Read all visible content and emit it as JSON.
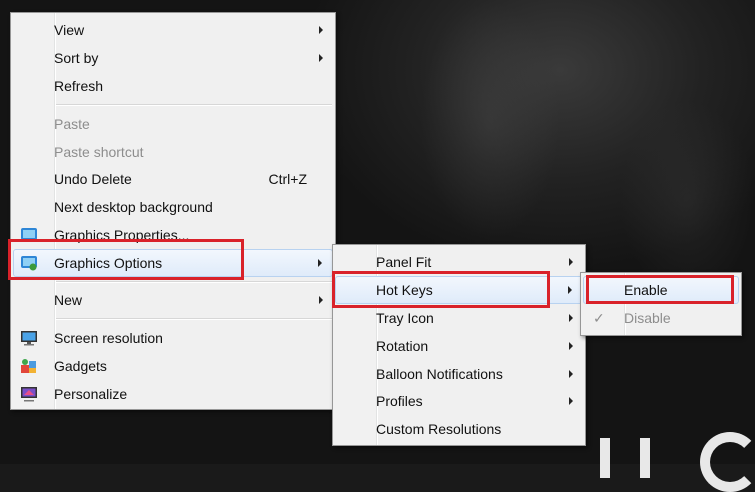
{
  "context_menu": {
    "items": [
      {
        "label": "View",
        "submenu": true
      },
      {
        "label": "Sort by",
        "submenu": true
      },
      {
        "label": "Refresh"
      },
      {
        "label": "Paste",
        "disabled": true
      },
      {
        "label": "Paste shortcut",
        "disabled": true
      },
      {
        "label": "Undo Delete",
        "shortcut": "Ctrl+Z"
      },
      {
        "label": "Next desktop background"
      },
      {
        "label": "Graphics Properties..."
      },
      {
        "label": "Graphics Options",
        "submenu": true,
        "highlighted": true
      },
      {
        "label": "New",
        "submenu": true
      },
      {
        "label": "Screen resolution"
      },
      {
        "label": "Gadgets"
      },
      {
        "label": "Personalize"
      }
    ]
  },
  "graphics_options_menu": {
    "items": [
      {
        "label": "Panel Fit",
        "submenu": true
      },
      {
        "label": "Hot Keys",
        "submenu": true,
        "highlighted": true
      },
      {
        "label": "Tray Icon",
        "submenu": true
      },
      {
        "label": "Rotation",
        "submenu": true
      },
      {
        "label": "Balloon Notifications",
        "submenu": true
      },
      {
        "label": "Profiles",
        "submenu": true
      },
      {
        "label": "Custom Resolutions"
      }
    ]
  },
  "hot_keys_menu": {
    "items": [
      {
        "label": "Enable",
        "highlighted": true
      },
      {
        "label": "Disable",
        "disabled": true,
        "checked": true,
        "check_glyph": "✓"
      }
    ]
  },
  "colors": {
    "annotation_red": "#d9222a",
    "highlight_border": "#b8d2f0",
    "disabled_text": "#8d8d8d"
  }
}
